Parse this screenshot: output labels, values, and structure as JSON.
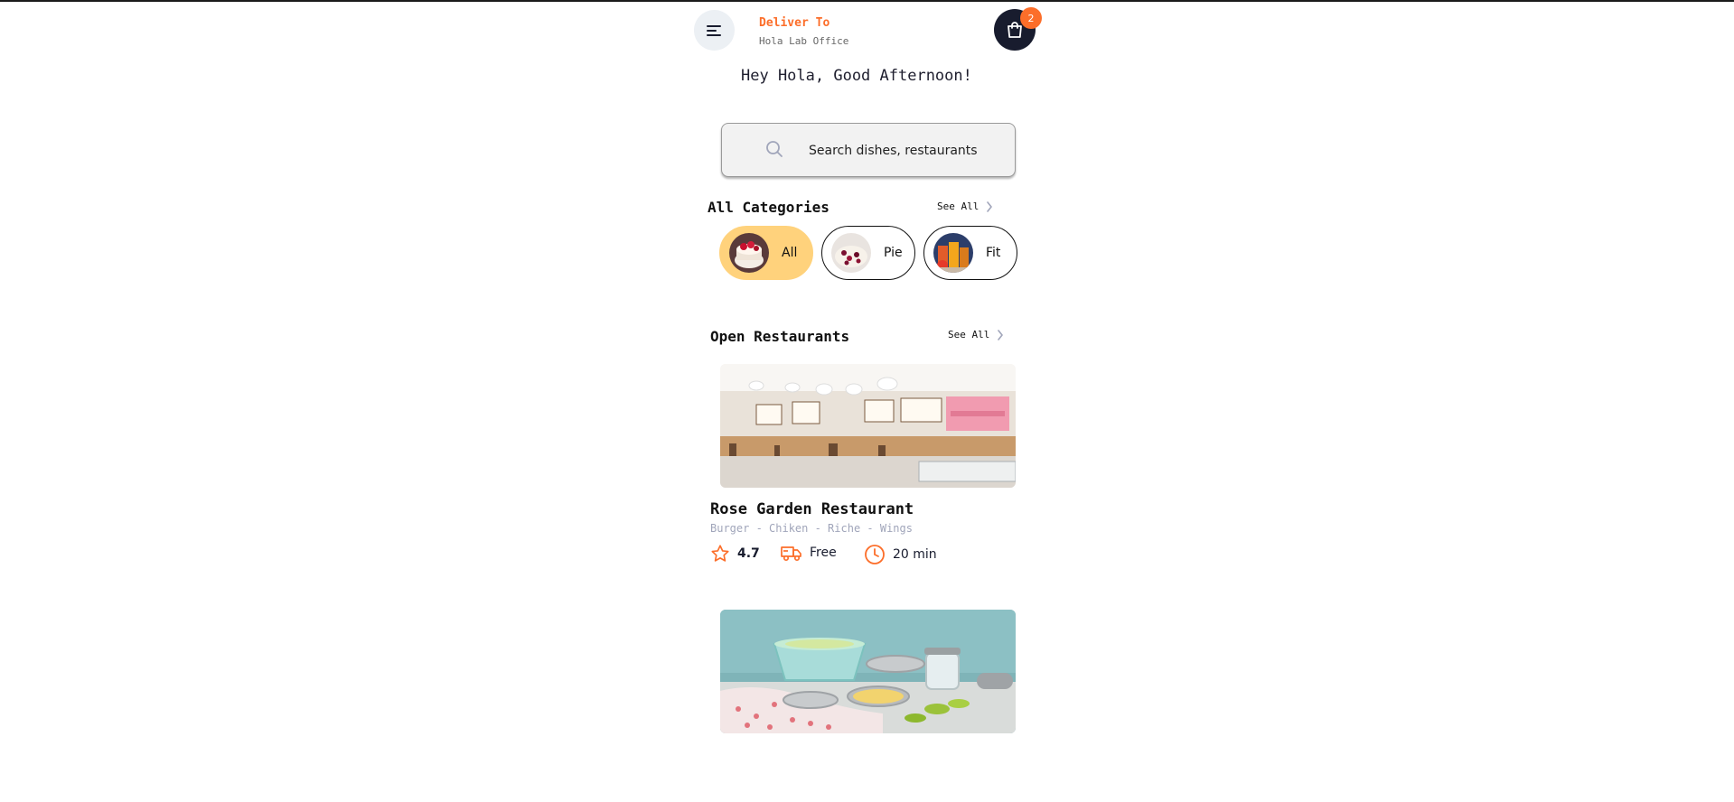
{
  "header": {
    "menu_icon": "menu-icon",
    "deliver_title": "Deliver To",
    "deliver_address": "Hola Lab Office",
    "cart_icon": "shopping-bag-icon",
    "cart_count": "2"
  },
  "greeting": "Hey Hola, Good Afternoon!",
  "search": {
    "icon": "search-icon",
    "placeholder": "Search dishes, restaurants"
  },
  "categories": {
    "title": "All Categories",
    "see_all": "See All",
    "items": [
      {
        "label": "All",
        "active": true
      },
      {
        "label": "Pie",
        "active": false
      },
      {
        "label": "Fit",
        "active": false
      }
    ]
  },
  "restaurants": {
    "title": "Open Restaurants",
    "see_all": "See All",
    "items": [
      {
        "name": "Rose Garden Restaurant",
        "tags": "Burger - Chiken - Riche - Wings",
        "rating": "4.7",
        "delivery": "Free",
        "time": "20 min"
      }
    ]
  },
  "colors": {
    "accent": "#fc6e2a",
    "chip_active": "#ffd27c",
    "dark": "#181c2e",
    "muted": "#a0a5ba"
  }
}
